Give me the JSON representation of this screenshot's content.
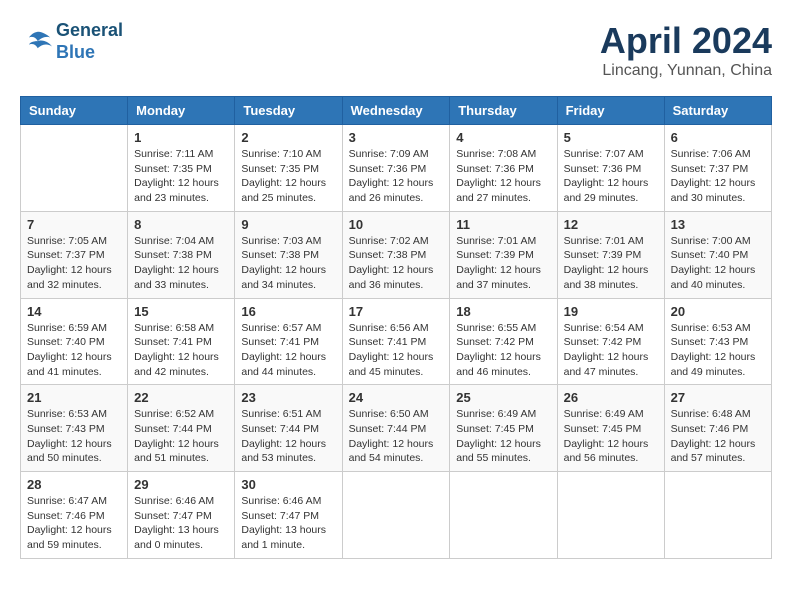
{
  "logo": {
    "line1": "General",
    "line2": "Blue"
  },
  "title": {
    "month": "April 2024",
    "location": "Lincang, Yunnan, China"
  },
  "weekdays": [
    "Sunday",
    "Monday",
    "Tuesday",
    "Wednesday",
    "Thursday",
    "Friday",
    "Saturday"
  ],
  "weeks": [
    [
      {
        "day": "",
        "info": ""
      },
      {
        "day": "1",
        "info": "Sunrise: 7:11 AM\nSunset: 7:35 PM\nDaylight: 12 hours\nand 23 minutes."
      },
      {
        "day": "2",
        "info": "Sunrise: 7:10 AM\nSunset: 7:35 PM\nDaylight: 12 hours\nand 25 minutes."
      },
      {
        "day": "3",
        "info": "Sunrise: 7:09 AM\nSunset: 7:36 PM\nDaylight: 12 hours\nand 26 minutes."
      },
      {
        "day": "4",
        "info": "Sunrise: 7:08 AM\nSunset: 7:36 PM\nDaylight: 12 hours\nand 27 minutes."
      },
      {
        "day": "5",
        "info": "Sunrise: 7:07 AM\nSunset: 7:36 PM\nDaylight: 12 hours\nand 29 minutes."
      },
      {
        "day": "6",
        "info": "Sunrise: 7:06 AM\nSunset: 7:37 PM\nDaylight: 12 hours\nand 30 minutes."
      }
    ],
    [
      {
        "day": "7",
        "info": "Sunrise: 7:05 AM\nSunset: 7:37 PM\nDaylight: 12 hours\nand 32 minutes."
      },
      {
        "day": "8",
        "info": "Sunrise: 7:04 AM\nSunset: 7:38 PM\nDaylight: 12 hours\nand 33 minutes."
      },
      {
        "day": "9",
        "info": "Sunrise: 7:03 AM\nSunset: 7:38 PM\nDaylight: 12 hours\nand 34 minutes."
      },
      {
        "day": "10",
        "info": "Sunrise: 7:02 AM\nSunset: 7:38 PM\nDaylight: 12 hours\nand 36 minutes."
      },
      {
        "day": "11",
        "info": "Sunrise: 7:01 AM\nSunset: 7:39 PM\nDaylight: 12 hours\nand 37 minutes."
      },
      {
        "day": "12",
        "info": "Sunrise: 7:01 AM\nSunset: 7:39 PM\nDaylight: 12 hours\nand 38 minutes."
      },
      {
        "day": "13",
        "info": "Sunrise: 7:00 AM\nSunset: 7:40 PM\nDaylight: 12 hours\nand 40 minutes."
      }
    ],
    [
      {
        "day": "14",
        "info": "Sunrise: 6:59 AM\nSunset: 7:40 PM\nDaylight: 12 hours\nand 41 minutes."
      },
      {
        "day": "15",
        "info": "Sunrise: 6:58 AM\nSunset: 7:41 PM\nDaylight: 12 hours\nand 42 minutes."
      },
      {
        "day": "16",
        "info": "Sunrise: 6:57 AM\nSunset: 7:41 PM\nDaylight: 12 hours\nand 44 minutes."
      },
      {
        "day": "17",
        "info": "Sunrise: 6:56 AM\nSunset: 7:41 PM\nDaylight: 12 hours\nand 45 minutes."
      },
      {
        "day": "18",
        "info": "Sunrise: 6:55 AM\nSunset: 7:42 PM\nDaylight: 12 hours\nand 46 minutes."
      },
      {
        "day": "19",
        "info": "Sunrise: 6:54 AM\nSunset: 7:42 PM\nDaylight: 12 hours\nand 47 minutes."
      },
      {
        "day": "20",
        "info": "Sunrise: 6:53 AM\nSunset: 7:43 PM\nDaylight: 12 hours\nand 49 minutes."
      }
    ],
    [
      {
        "day": "21",
        "info": "Sunrise: 6:53 AM\nSunset: 7:43 PM\nDaylight: 12 hours\nand 50 minutes."
      },
      {
        "day": "22",
        "info": "Sunrise: 6:52 AM\nSunset: 7:44 PM\nDaylight: 12 hours\nand 51 minutes."
      },
      {
        "day": "23",
        "info": "Sunrise: 6:51 AM\nSunset: 7:44 PM\nDaylight: 12 hours\nand 53 minutes."
      },
      {
        "day": "24",
        "info": "Sunrise: 6:50 AM\nSunset: 7:44 PM\nDaylight: 12 hours\nand 54 minutes."
      },
      {
        "day": "25",
        "info": "Sunrise: 6:49 AM\nSunset: 7:45 PM\nDaylight: 12 hours\nand 55 minutes."
      },
      {
        "day": "26",
        "info": "Sunrise: 6:49 AM\nSunset: 7:45 PM\nDaylight: 12 hours\nand 56 minutes."
      },
      {
        "day": "27",
        "info": "Sunrise: 6:48 AM\nSunset: 7:46 PM\nDaylight: 12 hours\nand 57 minutes."
      }
    ],
    [
      {
        "day": "28",
        "info": "Sunrise: 6:47 AM\nSunset: 7:46 PM\nDaylight: 12 hours\nand 59 minutes."
      },
      {
        "day": "29",
        "info": "Sunrise: 6:46 AM\nSunset: 7:47 PM\nDaylight: 13 hours\nand 0 minutes."
      },
      {
        "day": "30",
        "info": "Sunrise: 6:46 AM\nSunset: 7:47 PM\nDaylight: 13 hours\nand 1 minute."
      },
      {
        "day": "",
        "info": ""
      },
      {
        "day": "",
        "info": ""
      },
      {
        "day": "",
        "info": ""
      },
      {
        "day": "",
        "info": ""
      }
    ]
  ]
}
